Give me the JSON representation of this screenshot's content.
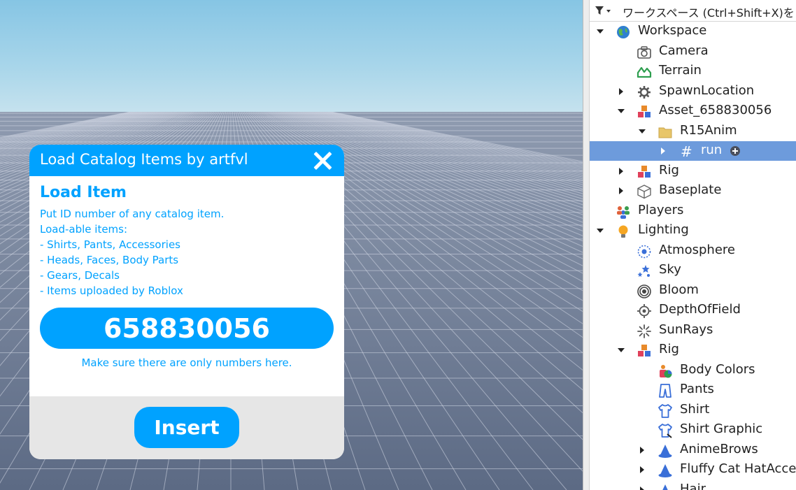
{
  "dialog": {
    "title": "Load Catalog Items by artfvl",
    "heading": "Load Item",
    "description": [
      "Put ID number of any catalog item.",
      "Load-able items:",
      "- Shirts, Pants, Accessories",
      "- Heads, Faces, Body Parts",
      "- Gears, Decals",
      "- Items uploaded by Roblox"
    ],
    "id_value": "658830056",
    "hint": "Make sure there are only numbers here.",
    "insert_label": "Insert"
  },
  "explorer": {
    "filter_placeholder": "ワークスペース (Ctrl+Shift+X)を",
    "items": [
      {
        "label": "Workspace",
        "icon": "workspace-globe-icon",
        "expand": "expanded"
      },
      {
        "label": "Camera",
        "icon": "camera-icon",
        "expand": "none"
      },
      {
        "label": "Terrain",
        "icon": "terrain-icon",
        "expand": "none"
      },
      {
        "label": "SpawnLocation",
        "icon": "spawn-gear-icon",
        "expand": "collapsed"
      },
      {
        "label": "Asset_658830056",
        "icon": "model-icon",
        "expand": "expanded"
      },
      {
        "label": "R15Anim",
        "icon": "folder-icon",
        "expand": "expanded"
      },
      {
        "label": "run",
        "icon": "script-hash-icon",
        "expand": "collapsed",
        "selected": true
      },
      {
        "label": "Rig",
        "icon": "model-icon",
        "expand": "collapsed"
      },
      {
        "label": "Baseplate",
        "icon": "part-cube-icon",
        "expand": "collapsed"
      },
      {
        "label": "Players",
        "icon": "players-icon",
        "expand": "none"
      },
      {
        "label": "Lighting",
        "icon": "lightbulb-icon",
        "expand": "expanded"
      },
      {
        "label": "Atmosphere",
        "icon": "atmosphere-icon",
        "expand": "none"
      },
      {
        "label": "Sky",
        "icon": "sky-stars-icon",
        "expand": "none"
      },
      {
        "label": "Bloom",
        "icon": "bloom-icon",
        "expand": "none"
      },
      {
        "label": "DepthOfField",
        "icon": "depth-of-field-icon",
        "expand": "none"
      },
      {
        "label": "SunRays",
        "icon": "sunrays-icon",
        "expand": "none"
      },
      {
        "label": "Rig",
        "icon": "model-icon",
        "expand": "expanded"
      },
      {
        "label": "Body Colors",
        "icon": "body-colors-icon",
        "expand": "none"
      },
      {
        "label": "Pants",
        "icon": "pants-icon",
        "expand": "none"
      },
      {
        "label": "Shirt",
        "icon": "shirt-icon",
        "expand": "none"
      },
      {
        "label": "Shirt Graphic",
        "icon": "shirt-graphic-icon",
        "expand": "none"
      },
      {
        "label": "AnimeBrows",
        "icon": "accessory-hat-icon",
        "expand": "collapsed"
      },
      {
        "label": "Fluffy Cat HatAccessory",
        "icon": "accessory-hat-icon",
        "expand": "collapsed"
      },
      {
        "label": "Hair",
        "icon": "accessory-hat-icon",
        "expand": "collapsed"
      }
    ]
  },
  "colors": {
    "accent": "#00a2ff",
    "selection": "#6d9bdc",
    "footer": "#e6e6e6"
  }
}
